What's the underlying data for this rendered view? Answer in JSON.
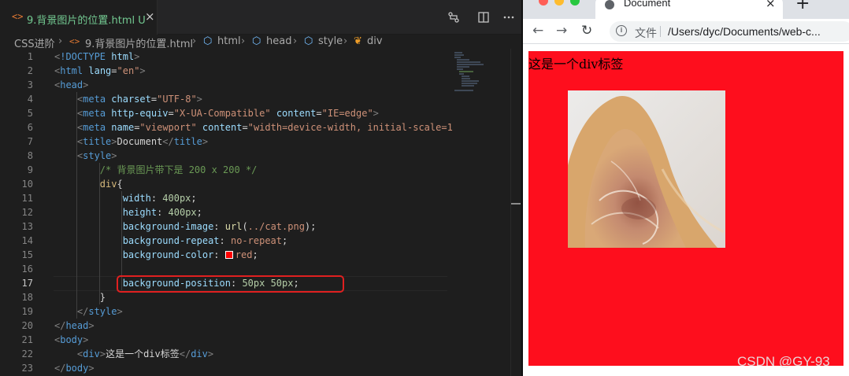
{
  "editor": {
    "tab": {
      "icon": "<>",
      "title": "9.背景图片的位置.html",
      "status": "U",
      "close": "×"
    },
    "actions": [
      "compare-changes-icon",
      "split-editor-icon",
      "more-actions-icon"
    ],
    "breadcrumb": [
      "CSS进阶",
      "9.背景图片的位置.html",
      "html",
      "head",
      "style",
      "div"
    ],
    "active_line": 17
  },
  "browser": {
    "tab_title": "Document",
    "tab_close": "×",
    "new_tab": "+",
    "omnibox_label": "文件",
    "url": "/Users/dyc/Documents/web-c...",
    "page": {
      "div_text": "这是一个div标签",
      "div_color": "#fe0e1d"
    }
  },
  "watermark": "CSDN @GY-93"
}
